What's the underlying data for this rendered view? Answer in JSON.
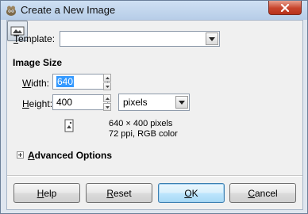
{
  "window": {
    "title": "Create a New Image",
    "close_icon": "close-icon"
  },
  "template": {
    "label_prefix": "T",
    "label_rest": "emplate:",
    "value": ""
  },
  "image_size": {
    "heading": "Image Size",
    "width_label_prefix": "W",
    "width_label_rest": "idth:",
    "width_value": "640",
    "height_label_prefix": "H",
    "height_label_rest": "eight:",
    "height_value": "400",
    "unit": "pixels",
    "dimensions_text": "640 × 400 pixels",
    "resolution_text": "72 ppi, RGB color"
  },
  "advanced": {
    "label_prefix": "A",
    "label_rest": "dvanced Options"
  },
  "buttons": {
    "help_prefix": "H",
    "help_rest": "elp",
    "reset_prefix": "R",
    "reset_rest": "eset",
    "ok_prefix": "O",
    "ok_rest": "K",
    "cancel_prefix": "C",
    "cancel_rest": "ancel"
  },
  "colors": {
    "accent": "#3399ff",
    "close": "#c7442c"
  }
}
